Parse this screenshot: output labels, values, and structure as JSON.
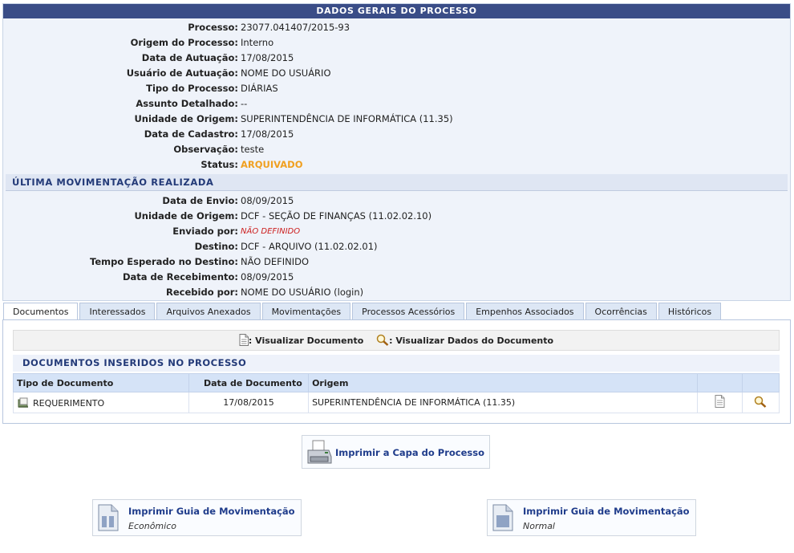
{
  "header": {
    "title": "DADOS GERAIS DO PROCESSO"
  },
  "general": [
    {
      "label": "Processo:",
      "value": "23077.041407/2015-93"
    },
    {
      "label": "Origem do Processo:",
      "value": "Interno"
    },
    {
      "label": "Data de Autuação:",
      "value": "17/08/2015"
    },
    {
      "label": "Usuário de Autuação:",
      "value": "NOME DO USUÁRIO"
    },
    {
      "label": "Tipo do Processo:",
      "value": "DIÁRIAS"
    },
    {
      "label": "Assunto Detalhado:",
      "value": "--"
    },
    {
      "label": "Unidade de Origem:",
      "value": "SUPERINTENDÊNCIA DE INFORMÁTICA (11.35)"
    },
    {
      "label": "Data de Cadastro:",
      "value": "17/08/2015"
    },
    {
      "label": "Observação:",
      "value": "teste"
    },
    {
      "label": "Status:",
      "value": "ARQUIVADO"
    }
  ],
  "movement": {
    "title": "ÚLTIMA MOVIMENTAÇÃO REALIZADA",
    "rows": [
      {
        "label": "Data de Envio:",
        "value": "08/09/2015"
      },
      {
        "label": "Unidade de Origem:",
        "value": "DCF - SEÇÃO DE FINANÇAS (11.02.02.10)"
      },
      {
        "label": "Enviado por:",
        "value": "NÃO DEFINIDO"
      },
      {
        "label": "Destino:",
        "value": "DCF - ARQUIVO (11.02.02.01)"
      },
      {
        "label": "Tempo Esperado no Destino:",
        "value": "NÃO DEFINIDO"
      },
      {
        "label": "Data de Recebimento:",
        "value": "08/09/2015"
      },
      {
        "label": "Recebido por:",
        "value": "NOME DO USUÁRIO (login)"
      }
    ]
  },
  "tabs": [
    "Documentos",
    "Interessados",
    "Arquivos Anexados",
    "Movimentações",
    "Processos Acessórios",
    "Empenhos Associados",
    "Ocorrências",
    "Históricos"
  ],
  "legend": {
    "view_doc": ": Visualizar Documento",
    "view_data": ": Visualizar Dados do Documento"
  },
  "documents": {
    "title": "DOCUMENTOS INSERIDOS NO PROCESSO",
    "columns": [
      "Tipo de Documento",
      "Data de Documento",
      "Origem"
    ],
    "rows": [
      {
        "type": "REQUERIMENTO",
        "date": "17/08/2015",
        "origin": "SUPERINTENDÊNCIA DE INFORMÁTICA (11.35)"
      }
    ]
  },
  "actions": {
    "print_cover": "Imprimir a Capa do Processo",
    "guide_economic_title": "Imprimir Guia de Movimentação",
    "guide_economic_sub": "Econômico",
    "guide_normal_title": "Imprimir Guia de Movimentação",
    "guide_normal_sub": "Normal"
  },
  "colors": {
    "header": "#3a4d87",
    "status": "#f0a020",
    "not_defined": "#cc1f1f",
    "link": "#1f3c8b"
  }
}
